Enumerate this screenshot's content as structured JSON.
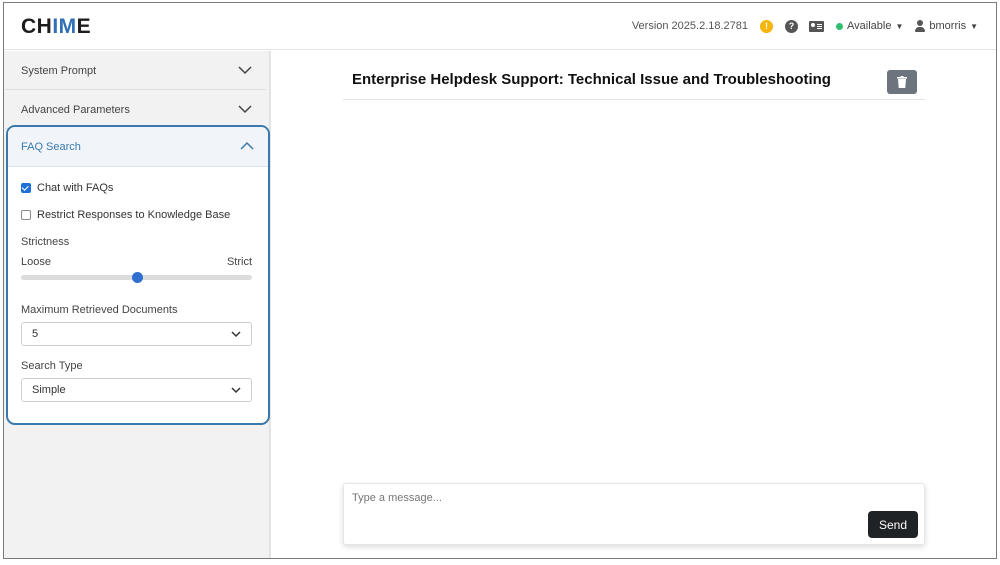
{
  "header": {
    "logo_prefix": "CH",
    "logo_accent": "IM",
    "logo_suffix": "E",
    "version": "Version 2025.2.18.2781",
    "warning_glyph": "!",
    "help_glyph": "?",
    "status": "Available",
    "username": "bmorris"
  },
  "sidebar": {
    "sections": [
      {
        "label": "System Prompt",
        "expanded": false
      },
      {
        "label": "Advanced Parameters",
        "expanded": false
      },
      {
        "label": "FAQ Search",
        "expanded": true
      }
    ],
    "faq": {
      "chat_with_faqs": {
        "label": "Chat with FAQs",
        "checked": true
      },
      "restrict_kb": {
        "label": "Restrict Responses to Knowledge Base",
        "checked": false
      },
      "strictness": {
        "label": "Strictness",
        "min_label": "Loose",
        "max_label": "Strict",
        "value_fraction": 0.5
      },
      "max_docs": {
        "label": "Maximum Retrieved Documents",
        "value": "5"
      },
      "search_type": {
        "label": "Search Type",
        "value": "Simple"
      }
    }
  },
  "main": {
    "title": "Enterprise Helpdesk Support: Technical Issue and Troubleshooting",
    "composer_placeholder": "Type a message...",
    "send_label": "Send"
  },
  "colors": {
    "accent": "#3a79ad",
    "status_available": "#2fbf71",
    "warning": "#f5b50a",
    "send_button": "#1f2326",
    "trash_button": "#6c757d"
  },
  "icons": [
    "warning-icon",
    "help-icon",
    "contact-card-icon",
    "user-icon",
    "chevron-down-icon",
    "chevron-up-icon",
    "trash-icon"
  ]
}
